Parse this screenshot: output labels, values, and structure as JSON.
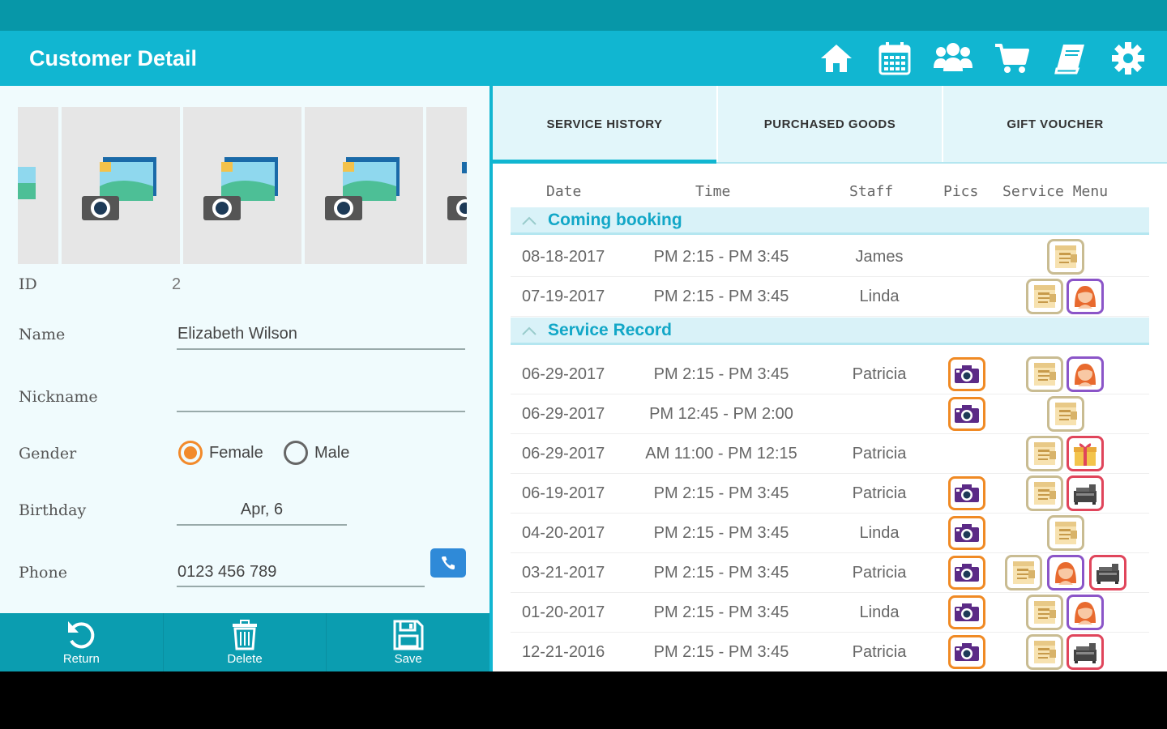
{
  "app": {
    "title": "Customer Detail"
  },
  "toolbar_icons": [
    "home-icon",
    "calendar-icon",
    "users-icon",
    "cart-icon",
    "book-icon",
    "gear-icon"
  ],
  "colors": {
    "accent": "#11b6d1",
    "status": "#0797a8",
    "radio_on": "#f28a2b",
    "section_text": "#12a7c7"
  },
  "customer": {
    "id_label": "ID",
    "id_value": "2",
    "name_label": "Name",
    "name_value": "Elizabeth Wilson",
    "nickname_label": "Nickname",
    "nickname_value": "",
    "gender_label": "Gender",
    "gender_female": "Female",
    "gender_male": "Male",
    "gender_selected": "Female",
    "birthday_label": "Birthday",
    "birthday_value": "Apr, 6",
    "phone_label": "Phone",
    "phone_value": "0123 456 789"
  },
  "bottom_actions": {
    "return": "Return",
    "delete": "Delete",
    "save": "Save"
  },
  "tabs": {
    "service_history": "SERVICE HISTORY",
    "purchased_goods": "PURCHASED GOODS",
    "gift_voucher": "GIFT VOUCHER"
  },
  "table": {
    "headers": {
      "date": "Date",
      "time": "Time",
      "staff": "Staff",
      "pics": "Pics",
      "service_menu": "Service Menu"
    },
    "coming_label": "Coming booking",
    "record_label": "Service Record",
    "coming": [
      {
        "date": "08-18-2017",
        "time": "PM 2:15 - PM 3:45",
        "staff": "James"
      },
      {
        "date": "07-19-2017",
        "time": "PM 2:15 - PM 3:45",
        "staff": "Linda"
      }
    ],
    "records": [
      {
        "date": "06-29-2017",
        "time": "PM 2:15 - PM 3:45",
        "staff": "Patricia"
      },
      {
        "date": "06-29-2017",
        "time": "PM 12:45 - PM 2:00",
        "staff": ""
      },
      {
        "date": "06-29-2017",
        "time": "AM 11:00 - PM 12:15",
        "staff": "Patricia"
      },
      {
        "date": "06-19-2017",
        "time": "PM 2:15 - PM 3:45",
        "staff": "Patricia"
      },
      {
        "date": "04-20-2017",
        "time": "PM 2:15 - PM 3:45",
        "staff": "Linda"
      },
      {
        "date": "03-21-2017",
        "time": "PM 2:15 - PM 3:45",
        "staff": "Patricia"
      },
      {
        "date": "01-20-2017",
        "time": "PM 2:15 - PM 3:45",
        "staff": "Linda"
      },
      {
        "date": "12-21-2016",
        "time": "PM 2:15 - PM 3:45",
        "staff": "Patricia"
      }
    ]
  }
}
